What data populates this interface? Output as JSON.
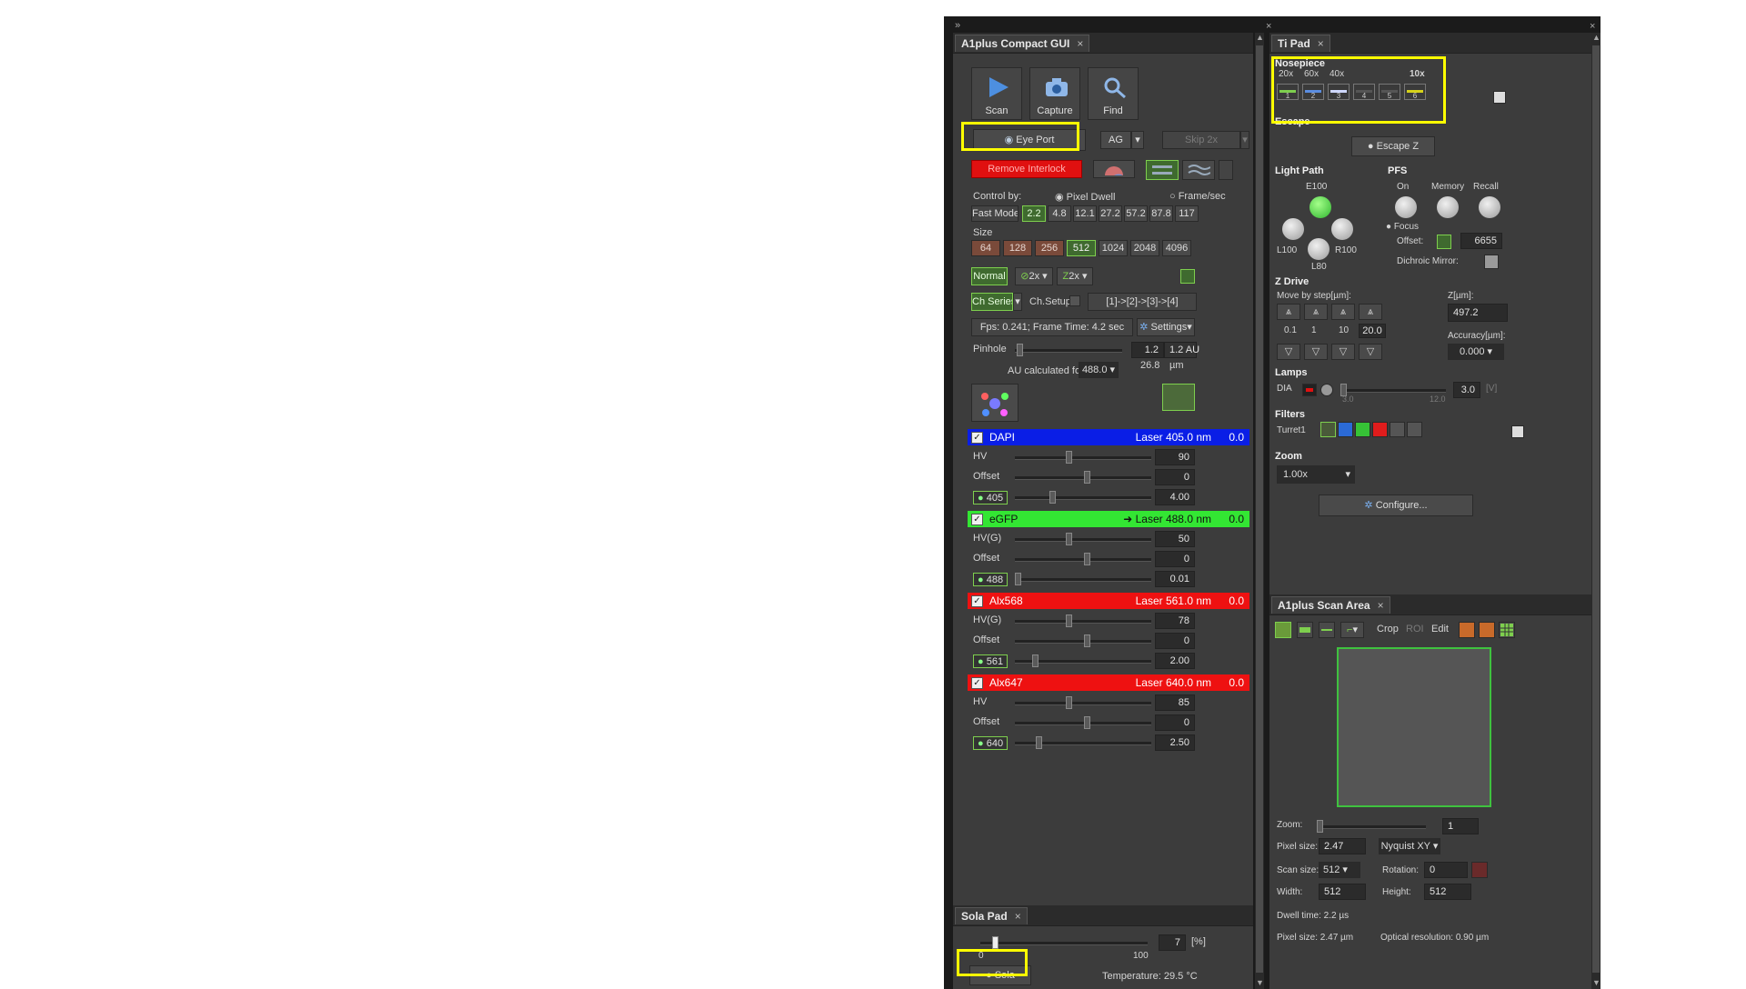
{
  "app": {
    "collapse_glyph": "»",
    "close_glyph": "×"
  },
  "left_panel": {
    "title": "A1plus Compact GUI",
    "toolbar": {
      "scan": "Scan",
      "capture": "Capture",
      "find": "Find"
    },
    "eye_port": "Eye Port",
    "ag": "AG",
    "skip": "Skip 2x",
    "remove_interlock": "Remove Interlock",
    "control_by_label": "Control by:",
    "pixel_dwell": "Pixel Dwell",
    "frame_sec": "Frame/sec",
    "fast_mode": "Fast Mode",
    "dwell_values": [
      "2.2",
      "4.8",
      "12.1",
      "27.2",
      "57.2",
      "87.8",
      "117"
    ],
    "dwell_selected": "2.2",
    "size_label": "Size",
    "size_values": [
      "64",
      "128",
      "256",
      "512",
      "1024",
      "2048",
      "4096"
    ],
    "size_selected": "512",
    "normal": "Normal",
    "zoom_a": "2x",
    "zoom_b": "2x",
    "ch_series": "Ch Series",
    "ch_setup": "Ch.Setup",
    "ch_sequence": "[1]->[2]->[3]->[4]",
    "fps_text": "Fps: 0.241; Frame Time: 4.2 sec",
    "settings": "Settings",
    "pinhole_label": "Pinhole",
    "pinhole_value": "1.2",
    "pinhole_au": "1.2 AU",
    "au_calc_label": "AU calculated for:",
    "au_calc_value": "488.0",
    "pinhole_um_value": "26.8",
    "pinhole_um_unit": "µm",
    "channels": [
      {
        "name": "DAPI",
        "laser": "Laser 405.0 nm",
        "power": "0.0",
        "color": "#0a1ee6",
        "checked": "✓",
        "hv_label": "HV",
        "hv": "90",
        "offset_label": "Offset",
        "offset": "0",
        "tag": "405",
        "laser_val": "4.00"
      },
      {
        "name": "eGFP",
        "laser": "➜ Laser 488.0 nm",
        "power": "0.0",
        "color": "#33e633",
        "checked": "✓",
        "hv_label": "HV(G)",
        "hv": "50",
        "offset_label": "Offset",
        "offset": "0",
        "tag": "488",
        "laser_val": "0.01"
      },
      {
        "name": "Alx568",
        "laser": "Laser 561.0 nm",
        "power": "0.0",
        "color": "#ee1111",
        "checked": "✓",
        "hv_label": "HV(G)",
        "hv": "78",
        "offset_label": "Offset",
        "offset": "0",
        "tag": "561",
        "laser_val": "2.00"
      },
      {
        "name": "Alx647",
        "laser": "Laser 640.0 nm",
        "power": "0.0",
        "color": "#ee1111",
        "checked": "✓",
        "hv_label": "HV",
        "hv": "85",
        "offset_label": "Offset",
        "offset": "0",
        "tag": "640",
        "laser_val": "2.50"
      }
    ]
  },
  "sola_pad": {
    "title": "Sola Pad",
    "slider_min": "0",
    "slider_max": "100",
    "value": "7",
    "unit": "[%]",
    "level_percent": 7,
    "sola": "Sola",
    "temperature": "Temperature: 29.5 °C"
  },
  "ti_pad": {
    "title": "Ti Pad",
    "nosepiece_label": "Nosepiece",
    "objectives": [
      "20x",
      "60x",
      "40x",
      "",
      "",
      "10x"
    ],
    "positions": [
      "1",
      "2",
      "3",
      "4",
      "5",
      "6"
    ],
    "escape_label": "Escape",
    "escape_z": "Escape Z",
    "light_path_label": "Light Path",
    "e100": "E100",
    "l100": "L100",
    "r100": "R100",
    "l80": "L80",
    "pfs_label": "PFS",
    "pfs_on": "On",
    "pfs_memory": "Memory",
    "pfs_recall": "Recall",
    "focus": "Focus",
    "offset_label": "Offset:",
    "offset_value": "6655",
    "dichroic_label": "Dichroic Mirror:",
    "zdrive_label": "Z Drive",
    "move_by_step": "Move by step[µm]:",
    "steps": [
      "0.1",
      "1",
      "10",
      "20.0"
    ],
    "z_um_label": "Z[µm]:",
    "z_value": "497.2",
    "accuracy_label": "Accuracy[µm]:",
    "accuracy_value": "0.000",
    "lamps_label": "Lamps",
    "dia": "DIA",
    "lamp_min": "3.0",
    "lamp_max": "12.0",
    "lamp_value": "3.0",
    "lamp_unit": "[V]",
    "filters_label": "Filters",
    "turret": "Turret1",
    "zoom_label": "Zoom",
    "zoom_value": "1.00x",
    "configure": "Configure..."
  },
  "scan_area": {
    "title": "A1plus Scan Area",
    "crop": "Crop",
    "roi": "ROI",
    "edit": "Edit",
    "zoom_label": "Zoom:",
    "zoom_value": "1",
    "pixel_size_label": "Pixel size:",
    "pixel_size_value": "2.47",
    "nyquist": "Nyquist XY",
    "scan_size_label": "Scan size:",
    "scan_size_value": "512",
    "rotation_label": "Rotation:",
    "rotation_value": "0",
    "width_label": "Width:",
    "width_value": "512",
    "height_label": "Height:",
    "height_value": "512",
    "dwell_time": "Dwell time: 2.2 µs",
    "pixel_size_footer": "Pixel size: 2.47 µm",
    "optical_resolution": "Optical resolution: 0.90 µm"
  },
  "colors": {
    "highlight": "#ffff00",
    "accent_green": "#7ecf4e",
    "interlock_red": "#e01010"
  }
}
